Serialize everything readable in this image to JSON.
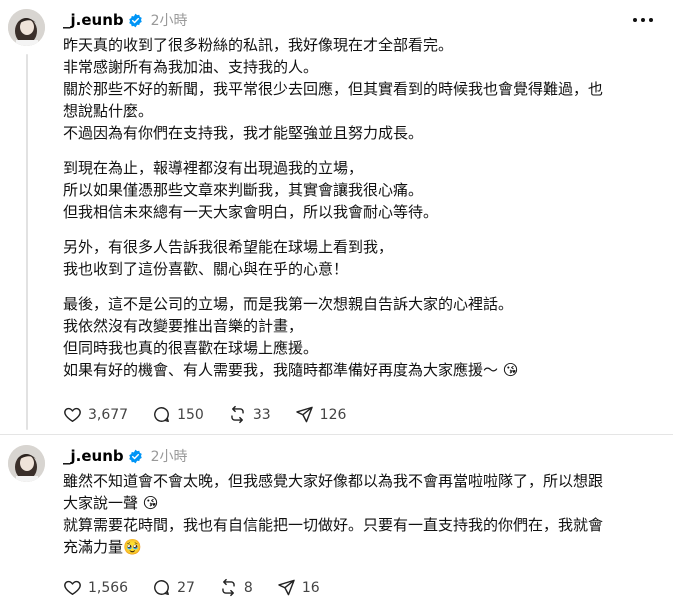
{
  "posts": [
    {
      "username": "_j.eunb",
      "time": "2小時",
      "paragraphs": [
        [
          "昨天真的收到了很多粉絲的私訊，我好像現在才全部看完。",
          "非常感謝所有為我加油、支持我的人。",
          "關於那些不好的新聞，我平常很少去回應，但其實看到的時候我也會覺得難過，也",
          "想說點什麼。",
          "不過因為有你們在支持我，我才能堅強並且努力成長。"
        ],
        [
          "到現在為止，報導裡都沒有出現過我的立場，",
          "所以如果僅憑那些文章來判斷我，其實會讓我很心痛。",
          "但我相信未來總有一天大家會明白，所以我會耐心等待。"
        ],
        [
          "另外，有很多人告訴我很希望能在球場上看到我，",
          "我也收到了這份喜歡、關心與在乎的心意！"
        ],
        [
          "最後，這不是公司的立場，而是我第一次想親自告訴大家的心裡話。",
          "我依然沒有改變要推出音樂的計畫，",
          "但同時我也真的很喜歡在球場上應援。",
          "如果有好的機會、有人需要我，我隨時都準備好再度為大家應援～ 😘"
        ]
      ],
      "likes": "3,677",
      "replies": "150",
      "reposts": "33",
      "shares": "126"
    },
    {
      "username": "_j.eunb",
      "time": "2小時",
      "paragraphs": [
        [
          "雖然不知道會不會太晚，但我感覺大家好像都以為我不會再當啦啦隊了，所以想跟",
          "大家說一聲 😘",
          "就算需要花時間，我也有自信能把一切做好。只要有一直支持我的你們在，我就會",
          "充滿力量🥹"
        ]
      ],
      "likes": "1,566",
      "replies": "27",
      "reposts": "8",
      "shares": "16"
    }
  ],
  "colors": {
    "verified": "#0095f6",
    "muted": "#999999",
    "divider": "#e5e5e5"
  },
  "icons": [
    "heart-icon",
    "comment-icon",
    "repost-icon",
    "share-icon",
    "more-icon",
    "verified-icon"
  ]
}
